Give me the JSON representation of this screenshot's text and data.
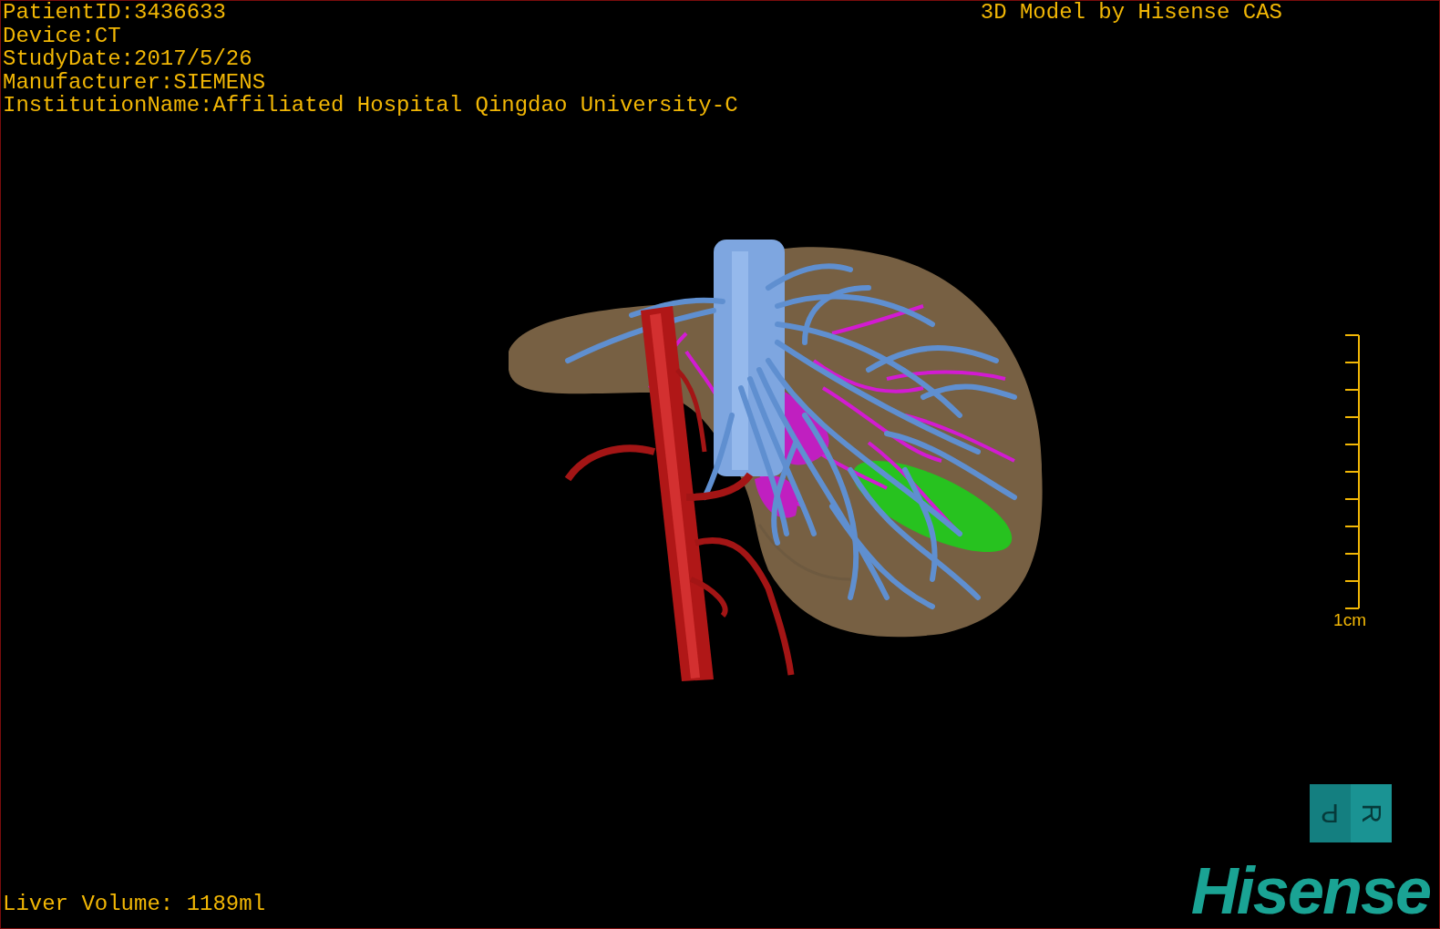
{
  "info_lines": [
    "PatientID:3436633",
    "Device:CT",
    "StudyDate:2017/5/26",
    "Manufacturer:SIEMENS",
    "InstitutionName:Affiliated Hospital Qingdao University-C"
  ],
  "title": "3D Model by Hisense CAS",
  "scale": {
    "label": "1cm"
  },
  "volume": "Liver Volume: 1189ml",
  "orientation_cube": {
    "faces": [
      "P",
      "R"
    ]
  },
  "logo": "Hisense"
}
